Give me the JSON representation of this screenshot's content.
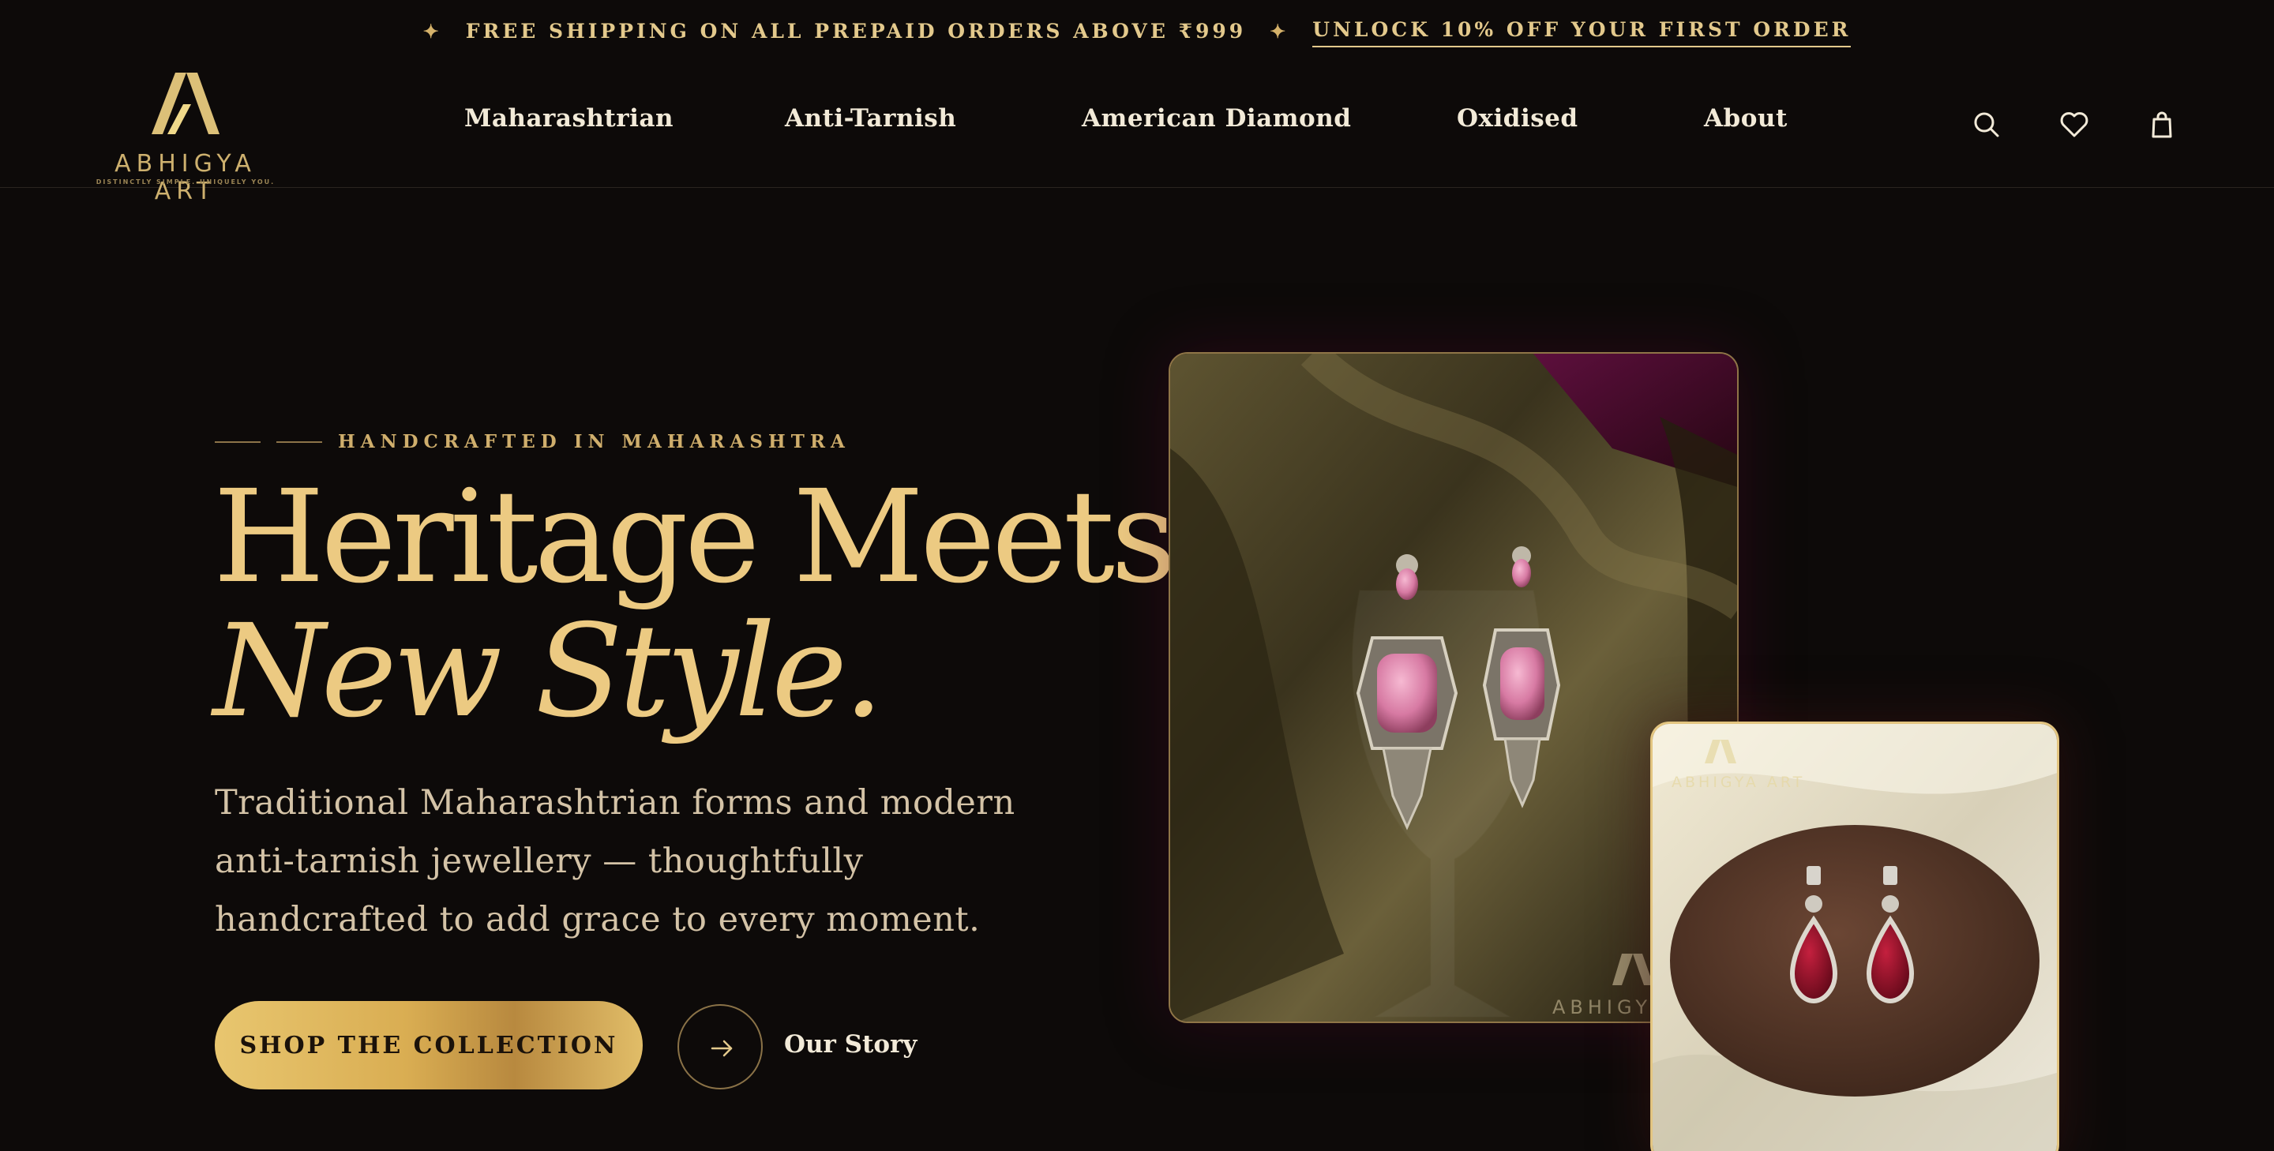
{
  "announcement": {
    "shipping_text": "FREE SHIPPING ON ALL PREPAID ORDERS ABOVE ₹999",
    "offer_link": "UNLOCK 10% OFF YOUR FIRST ORDER"
  },
  "brand": {
    "name": "ABHIGYA ART",
    "tagline": "DISTINCTLY SIMPLE. UNIQUELY YOU."
  },
  "nav": {
    "items": [
      {
        "label": "Maharashtrian"
      },
      {
        "label": "Anti-Tarnish"
      },
      {
        "label": "American Diamond"
      },
      {
        "label": "Oxidised"
      },
      {
        "label": "About"
      }
    ]
  },
  "header_icons": [
    "search-icon",
    "heart-icon",
    "shopping-bag-icon"
  ],
  "hero": {
    "eyebrow": "HANDCRAFTED IN MAHARASHTRA",
    "headline_line1": "Heritage Meets",
    "headline_line2": "New Style.",
    "description": "Traditional Maharashtrian forms and modern anti-tarnish jewellery — thoughtfully handcrafted to add grace to every moment.",
    "cta_label": "SHOP THE COLLECTION",
    "secondary_label": "Our Story"
  },
  "images": {
    "main_watermark": "ABHIGYA",
    "small_watermark": "ABHIGYA ART"
  },
  "colors": {
    "background": "#0d0a09",
    "gold": "#ecca82",
    "accent_gold": "#d9ad52",
    "text_light": "#f2ead8"
  }
}
